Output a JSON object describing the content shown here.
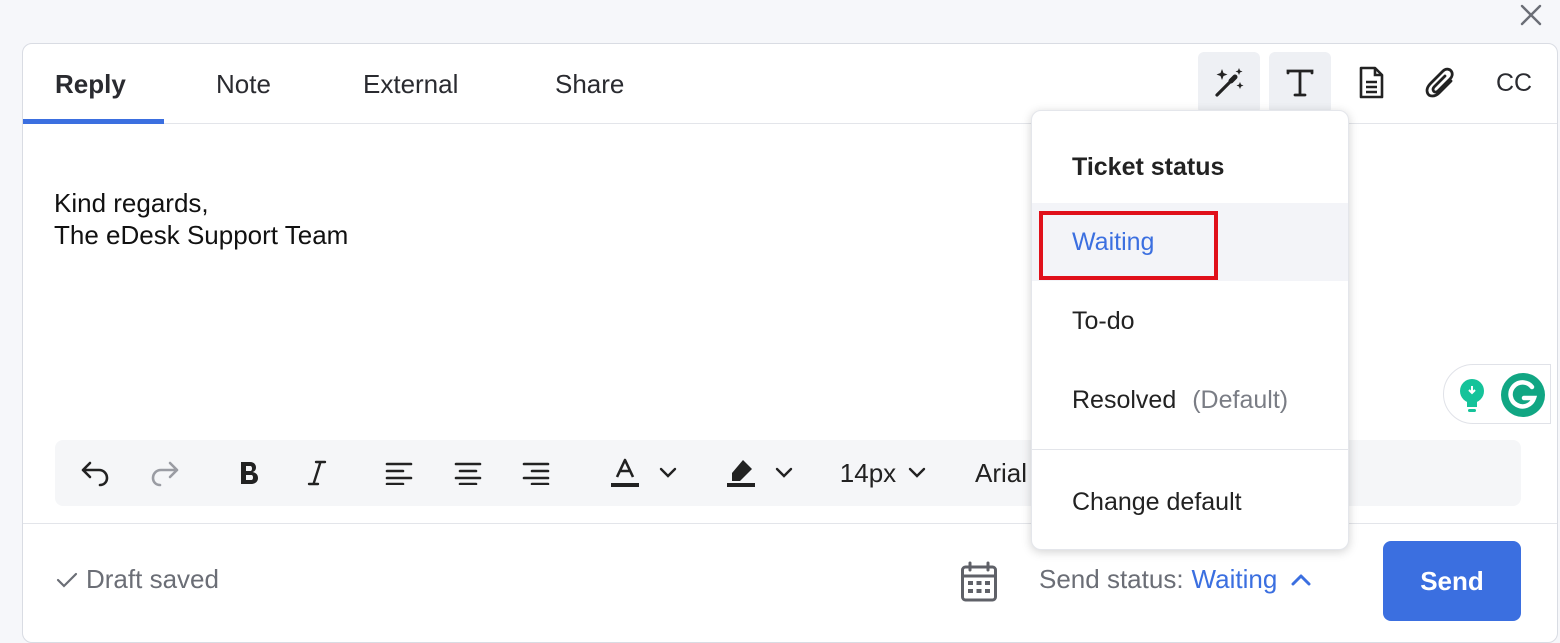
{
  "tabs": [
    {
      "label": "Reply",
      "active": true
    },
    {
      "label": "Note",
      "active": false
    },
    {
      "label": "External",
      "active": false
    },
    {
      "label": "Share",
      "active": false
    }
  ],
  "toolbar": {
    "cc_label": "CC",
    "icons": [
      "magic-wand-icon",
      "text-format-icon",
      "document-icon",
      "paperclip-icon"
    ]
  },
  "editor": {
    "body": "Kind regards,\nThe eDesk Support Team"
  },
  "format_bar": {
    "font_size": "14px",
    "font_family": "Arial"
  },
  "footer": {
    "draft_status": "Draft saved",
    "send_status_label": "Send status:",
    "send_status_value": "Waiting",
    "send_label": "Send"
  },
  "dropdown": {
    "title": "Ticket status",
    "items": [
      {
        "label": "Waiting",
        "selected": true
      },
      {
        "label": "To-do",
        "selected": false
      },
      {
        "label": "Resolved",
        "suffix": "(Default)",
        "selected": false
      }
    ],
    "change_default": "Change default"
  },
  "colors": {
    "accent": "#3b6fe0",
    "highlight_box": "#e0101a"
  }
}
